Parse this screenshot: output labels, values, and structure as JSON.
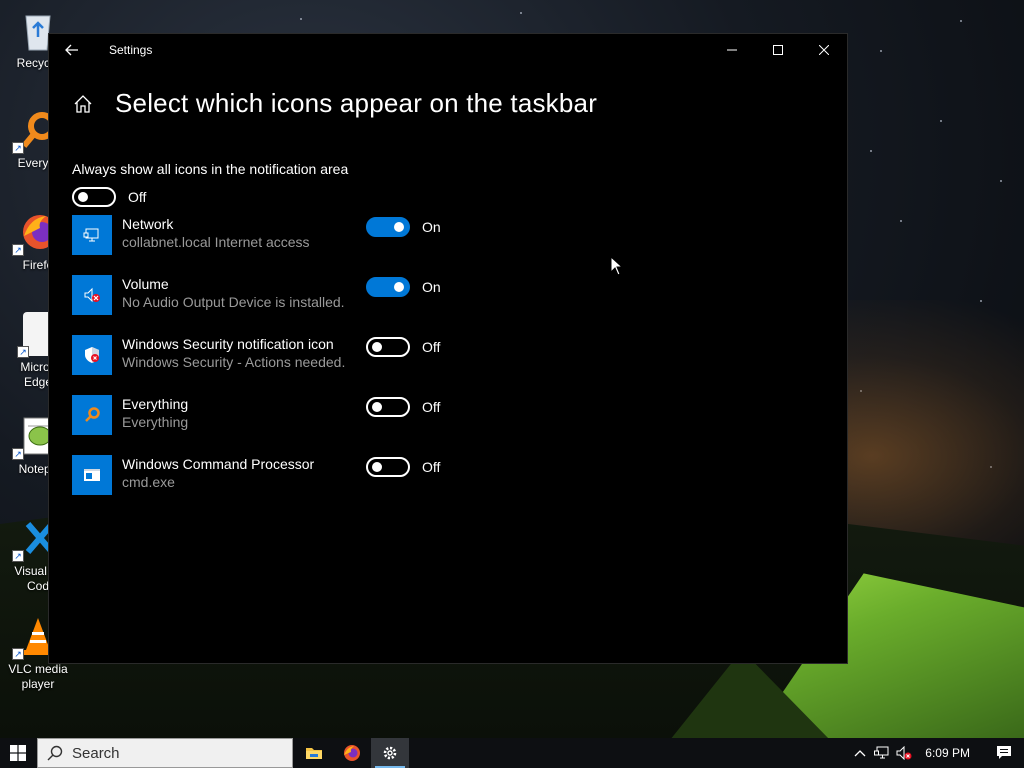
{
  "desktop": {
    "icons": [
      {
        "label": "Recycle",
        "icon": "recycle-bin-icon"
      },
      {
        "label": "Everyth",
        "icon": "everything-icon"
      },
      {
        "label": "Firefo",
        "icon": "firefox-icon"
      },
      {
        "label": "Micros Edge",
        "icon": "edge-icon"
      },
      {
        "label": "Notepa",
        "icon": "notepad-icon"
      },
      {
        "label": "Visual St Cod",
        "icon": "vscode-icon"
      },
      {
        "label": "VLC media player",
        "icon": "vlc-icon"
      }
    ]
  },
  "window": {
    "title": "Settings",
    "page_title": "Select which icons appear on the taskbar",
    "always_show": {
      "caption": "Always show all icons in the notification area",
      "state": "Off",
      "on": false
    },
    "items": [
      {
        "name": "Network",
        "desc": "collabnet.local Internet access",
        "state": "On",
        "on": true,
        "icon": "network-icon"
      },
      {
        "name": "Volume",
        "desc": "No Audio Output Device is installed.",
        "state": "On",
        "on": true,
        "icon": "volume-muted-icon"
      },
      {
        "name": "Windows Security notification icon",
        "desc": "Windows Security - Actions needed.",
        "state": "Off",
        "on": false,
        "icon": "shield-warning-icon"
      },
      {
        "name": "Everything",
        "desc": "Everything",
        "state": "Off",
        "on": false,
        "icon": "everything-search-icon"
      },
      {
        "name": "Windows Command Processor",
        "desc": "cmd.exe",
        "state": "Off",
        "on": false,
        "icon": "cmd-icon"
      }
    ]
  },
  "taskbar": {
    "search_placeholder": "Search",
    "clock": "6:09 PM",
    "apps": [
      "file-explorer-icon",
      "firefox-icon",
      "settings-gear-icon"
    ],
    "active_app": "settings-gear-icon"
  },
  "colors": {
    "accent": "#0078d7",
    "window_bg": "#000000",
    "secondary_text": "#9a9a9a"
  }
}
